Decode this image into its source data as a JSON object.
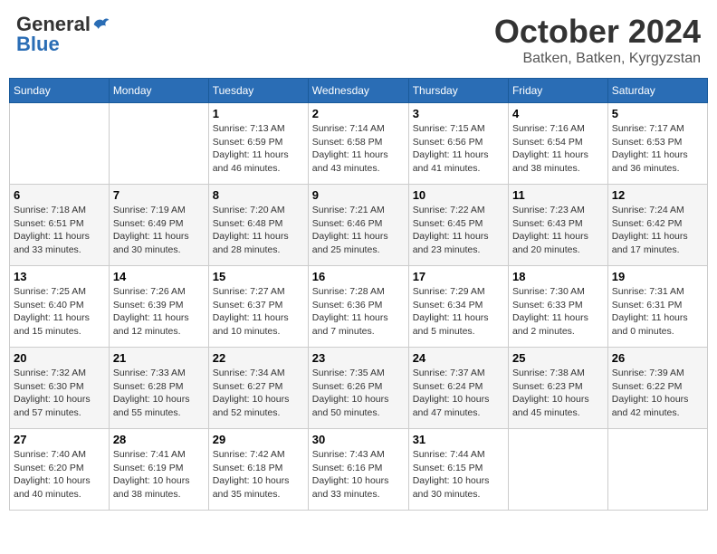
{
  "header": {
    "logo_general": "General",
    "logo_blue": "Blue",
    "month_title": "October 2024",
    "location": "Batken, Batken, Kyrgyzstan"
  },
  "days_of_week": [
    "Sunday",
    "Monday",
    "Tuesday",
    "Wednesday",
    "Thursday",
    "Friday",
    "Saturday"
  ],
  "weeks": [
    [
      {
        "day": null
      },
      {
        "day": null
      },
      {
        "day": "1",
        "sunrise": "Sunrise: 7:13 AM",
        "sunset": "Sunset: 6:59 PM",
        "daylight": "Daylight: 11 hours and 46 minutes."
      },
      {
        "day": "2",
        "sunrise": "Sunrise: 7:14 AM",
        "sunset": "Sunset: 6:58 PM",
        "daylight": "Daylight: 11 hours and 43 minutes."
      },
      {
        "day": "3",
        "sunrise": "Sunrise: 7:15 AM",
        "sunset": "Sunset: 6:56 PM",
        "daylight": "Daylight: 11 hours and 41 minutes."
      },
      {
        "day": "4",
        "sunrise": "Sunrise: 7:16 AM",
        "sunset": "Sunset: 6:54 PM",
        "daylight": "Daylight: 11 hours and 38 minutes."
      },
      {
        "day": "5",
        "sunrise": "Sunrise: 7:17 AM",
        "sunset": "Sunset: 6:53 PM",
        "daylight": "Daylight: 11 hours and 36 minutes."
      }
    ],
    [
      {
        "day": "6",
        "sunrise": "Sunrise: 7:18 AM",
        "sunset": "Sunset: 6:51 PM",
        "daylight": "Daylight: 11 hours and 33 minutes."
      },
      {
        "day": "7",
        "sunrise": "Sunrise: 7:19 AM",
        "sunset": "Sunset: 6:49 PM",
        "daylight": "Daylight: 11 hours and 30 minutes."
      },
      {
        "day": "8",
        "sunrise": "Sunrise: 7:20 AM",
        "sunset": "Sunset: 6:48 PM",
        "daylight": "Daylight: 11 hours and 28 minutes."
      },
      {
        "day": "9",
        "sunrise": "Sunrise: 7:21 AM",
        "sunset": "Sunset: 6:46 PM",
        "daylight": "Daylight: 11 hours and 25 minutes."
      },
      {
        "day": "10",
        "sunrise": "Sunrise: 7:22 AM",
        "sunset": "Sunset: 6:45 PM",
        "daylight": "Daylight: 11 hours and 23 minutes."
      },
      {
        "day": "11",
        "sunrise": "Sunrise: 7:23 AM",
        "sunset": "Sunset: 6:43 PM",
        "daylight": "Daylight: 11 hours and 20 minutes."
      },
      {
        "day": "12",
        "sunrise": "Sunrise: 7:24 AM",
        "sunset": "Sunset: 6:42 PM",
        "daylight": "Daylight: 11 hours and 17 minutes."
      }
    ],
    [
      {
        "day": "13",
        "sunrise": "Sunrise: 7:25 AM",
        "sunset": "Sunset: 6:40 PM",
        "daylight": "Daylight: 11 hours and 15 minutes."
      },
      {
        "day": "14",
        "sunrise": "Sunrise: 7:26 AM",
        "sunset": "Sunset: 6:39 PM",
        "daylight": "Daylight: 11 hours and 12 minutes."
      },
      {
        "day": "15",
        "sunrise": "Sunrise: 7:27 AM",
        "sunset": "Sunset: 6:37 PM",
        "daylight": "Daylight: 11 hours and 10 minutes."
      },
      {
        "day": "16",
        "sunrise": "Sunrise: 7:28 AM",
        "sunset": "Sunset: 6:36 PM",
        "daylight": "Daylight: 11 hours and 7 minutes."
      },
      {
        "day": "17",
        "sunrise": "Sunrise: 7:29 AM",
        "sunset": "Sunset: 6:34 PM",
        "daylight": "Daylight: 11 hours and 5 minutes."
      },
      {
        "day": "18",
        "sunrise": "Sunrise: 7:30 AM",
        "sunset": "Sunset: 6:33 PM",
        "daylight": "Daylight: 11 hours and 2 minutes."
      },
      {
        "day": "19",
        "sunrise": "Sunrise: 7:31 AM",
        "sunset": "Sunset: 6:31 PM",
        "daylight": "Daylight: 11 hours and 0 minutes."
      }
    ],
    [
      {
        "day": "20",
        "sunrise": "Sunrise: 7:32 AM",
        "sunset": "Sunset: 6:30 PM",
        "daylight": "Daylight: 10 hours and 57 minutes."
      },
      {
        "day": "21",
        "sunrise": "Sunrise: 7:33 AM",
        "sunset": "Sunset: 6:28 PM",
        "daylight": "Daylight: 10 hours and 55 minutes."
      },
      {
        "day": "22",
        "sunrise": "Sunrise: 7:34 AM",
        "sunset": "Sunset: 6:27 PM",
        "daylight": "Daylight: 10 hours and 52 minutes."
      },
      {
        "day": "23",
        "sunrise": "Sunrise: 7:35 AM",
        "sunset": "Sunset: 6:26 PM",
        "daylight": "Daylight: 10 hours and 50 minutes."
      },
      {
        "day": "24",
        "sunrise": "Sunrise: 7:37 AM",
        "sunset": "Sunset: 6:24 PM",
        "daylight": "Daylight: 10 hours and 47 minutes."
      },
      {
        "day": "25",
        "sunrise": "Sunrise: 7:38 AM",
        "sunset": "Sunset: 6:23 PM",
        "daylight": "Daylight: 10 hours and 45 minutes."
      },
      {
        "day": "26",
        "sunrise": "Sunrise: 7:39 AM",
        "sunset": "Sunset: 6:22 PM",
        "daylight": "Daylight: 10 hours and 42 minutes."
      }
    ],
    [
      {
        "day": "27",
        "sunrise": "Sunrise: 7:40 AM",
        "sunset": "Sunset: 6:20 PM",
        "daylight": "Daylight: 10 hours and 40 minutes."
      },
      {
        "day": "28",
        "sunrise": "Sunrise: 7:41 AM",
        "sunset": "Sunset: 6:19 PM",
        "daylight": "Daylight: 10 hours and 38 minutes."
      },
      {
        "day": "29",
        "sunrise": "Sunrise: 7:42 AM",
        "sunset": "Sunset: 6:18 PM",
        "daylight": "Daylight: 10 hours and 35 minutes."
      },
      {
        "day": "30",
        "sunrise": "Sunrise: 7:43 AM",
        "sunset": "Sunset: 6:16 PM",
        "daylight": "Daylight: 10 hours and 33 minutes."
      },
      {
        "day": "31",
        "sunrise": "Sunrise: 7:44 AM",
        "sunset": "Sunset: 6:15 PM",
        "daylight": "Daylight: 10 hours and 30 minutes."
      },
      {
        "day": null
      },
      {
        "day": null
      }
    ]
  ]
}
